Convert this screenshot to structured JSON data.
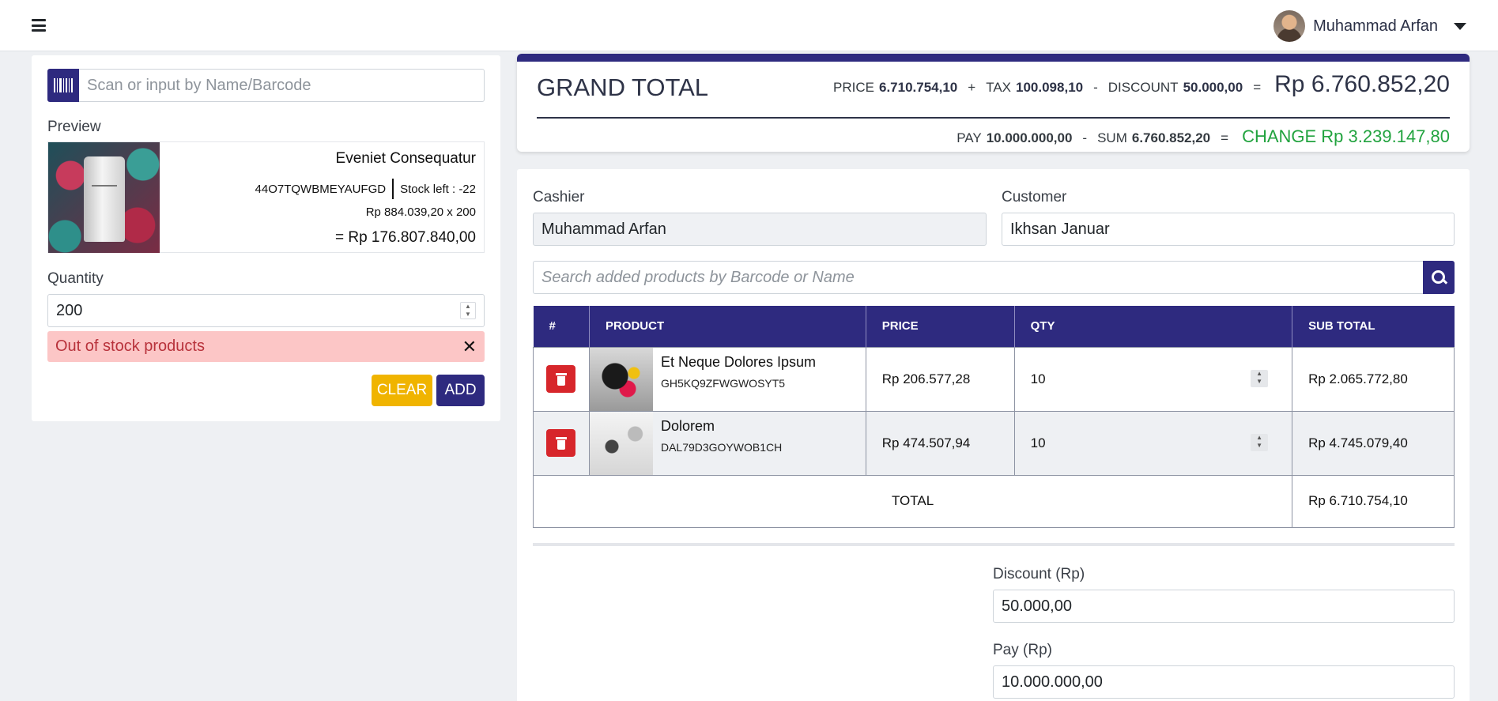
{
  "header": {
    "user_name": "Muhammad Arfan"
  },
  "scanner": {
    "placeholder": "Scan or input by Name/Barcode"
  },
  "preview": {
    "label": "Preview",
    "product_name": "Eveniet Consequatur",
    "barcode": "44O7TQWBMEYAUFGD",
    "stock_label": "Stock left :",
    "stock_value": "-22",
    "price_line": "Rp 884.039,20 x 200",
    "total_line": "= Rp 176.807.840,00"
  },
  "quantity": {
    "label": "Quantity",
    "value": "200"
  },
  "alert": {
    "text": "Out of stock products",
    "close": "✕"
  },
  "buttons": {
    "clear": "CLEAR",
    "add": "ADD"
  },
  "grand_total": {
    "title": "GRAND TOTAL",
    "price_label": "PRICE",
    "price_value": "6.710.754,10",
    "plus": "+",
    "tax_label": "TAX",
    "tax_value": "100.098,10",
    "minus": "-",
    "discount_label": "DISCOUNT",
    "discount_value": "50.000,00",
    "equals": "=",
    "total": "Rp 6.760.852,20",
    "pay_label": "PAY",
    "pay_value": "10.000.000,00",
    "sum_label": "SUM",
    "sum_value": "6.760.852,20",
    "change": "CHANGE Rp 3.239.147,80"
  },
  "form": {
    "cashier_label": "Cashier",
    "cashier_value": "Muhammad Arfan",
    "customer_label": "Customer",
    "customer_value": "Ikhsan Januar",
    "search_placeholder": "Search added products by Barcode or Name"
  },
  "cart": {
    "headers": [
      "#",
      "PRODUCT",
      "PRICE",
      "QTY",
      "SUB TOTAL"
    ],
    "rows": [
      {
        "name": "Et Neque Dolores Ipsum",
        "code": "GH5KQ9ZFWGWOSYT5",
        "price": "Rp 206.577,28",
        "qty": "10",
        "subtotal": "Rp 2.065.772,80"
      },
      {
        "name": "Dolorem",
        "code": "DAL79D3GOYWOB1CH",
        "price": "Rp 474.507,94",
        "qty": "10",
        "subtotal": "Rp 4.745.079,40"
      }
    ],
    "total_label": "TOTAL",
    "total_value": "Rp 6.710.754,10"
  },
  "payment": {
    "discount_label": "Discount (Rp)",
    "discount_value": "50.000,00",
    "pay_label": "Pay (Rp)",
    "pay_value": "10.000.000,00"
  },
  "colors": {
    "primary": "#2e2a7f",
    "warning": "#f0b400",
    "danger": "#d7262b",
    "success": "#22a33f",
    "alert_bg": "#fcc6c6"
  }
}
